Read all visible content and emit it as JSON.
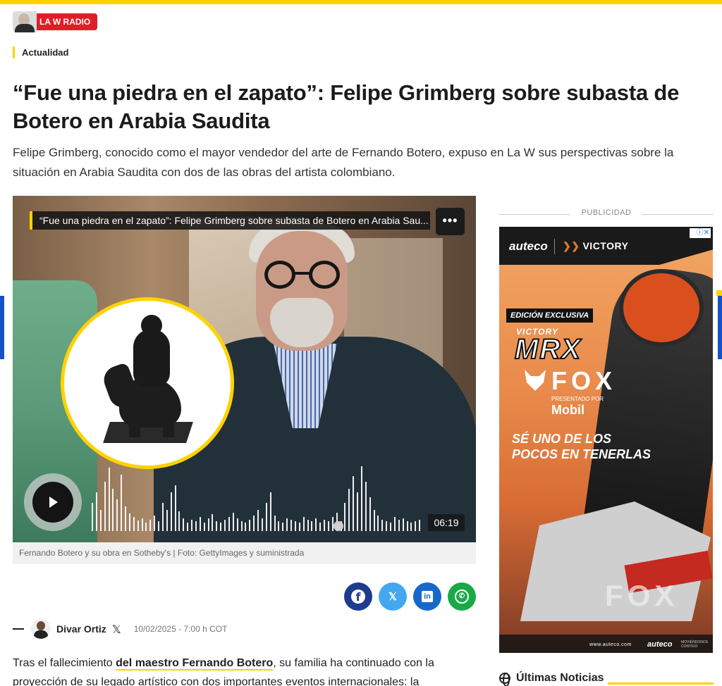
{
  "colors": {
    "accent": "#ffd200",
    "brand_red": "#e01e26",
    "facebook": "#1f3b8f",
    "x": "#43a8ef",
    "linkedin": "#1769c9",
    "whatsapp": "#1aa947"
  },
  "brand": {
    "name": "LA W RADIO"
  },
  "section": {
    "label": "Actualidad"
  },
  "article": {
    "headline": "“Fue una piedra en el zapato”: Felipe Grimberg sobre subasta de Botero en Arabia Saudita",
    "lead": "Felipe Grimberg, conocido como el mayor vendedor del arte de Fernando Botero, expuso en La W sus perspectivas sobre la situación en Arabia Saudita con dos de las obras del artista colombiano.",
    "body_prefix": "Tras el fallecimiento ",
    "body_link": "del maestro Fernando Botero",
    "body_suffix": ", su familia ha continuado con la proyección de su legado artístico con dos importantes eventos internacionales: la"
  },
  "player": {
    "title": "“Fue una piedra en el zapato”: Felipe Grimberg sobre subasta de Botero en Arabia Sau...",
    "more_label": "•••",
    "duration": "06:19",
    "icons": {
      "more": "more-icon",
      "play": "play-icon"
    }
  },
  "caption": "Fernando Botero y su obra en Sotheby's | Foto: GettyImages y suministrada",
  "share": [
    {
      "network": "facebook",
      "icon": "facebook-icon",
      "glyph": "f"
    },
    {
      "network": "x",
      "icon": "x-icon",
      "glyph": "𝕏"
    },
    {
      "network": "linkedin",
      "icon": "linkedin-icon",
      "glyph": "in"
    },
    {
      "network": "whatsapp",
      "icon": "whatsapp-icon",
      "glyph": "✆"
    }
  ],
  "author": {
    "name": "Divar Ortiz",
    "x_glyph": "𝕏",
    "date": "10/02/2025 - 7:00 h COT"
  },
  "sidebar": {
    "ad_label": "PUBLICIDAD",
    "ad": {
      "brand1": "auteco",
      "brand2": "VICTORY",
      "info": "ⓘ✕",
      "badge": "EDICIÓN EXCLUSIVA",
      "victory_small": "VICTORY",
      "model": "MRX",
      "partner": "FOX",
      "presented": "PRESENTADO POR",
      "oil": "Mobil",
      "slogan": "SÉ UNO DE LOS POCOS EN TENERLAS",
      "fox_big": "FOX",
      "footer_url": "www.auteco.com",
      "footer_logo": "auteco",
      "footer_small": "MOVIÉNDONOS CONTIGO"
    },
    "latest_label": "Últimas Noticias"
  }
}
